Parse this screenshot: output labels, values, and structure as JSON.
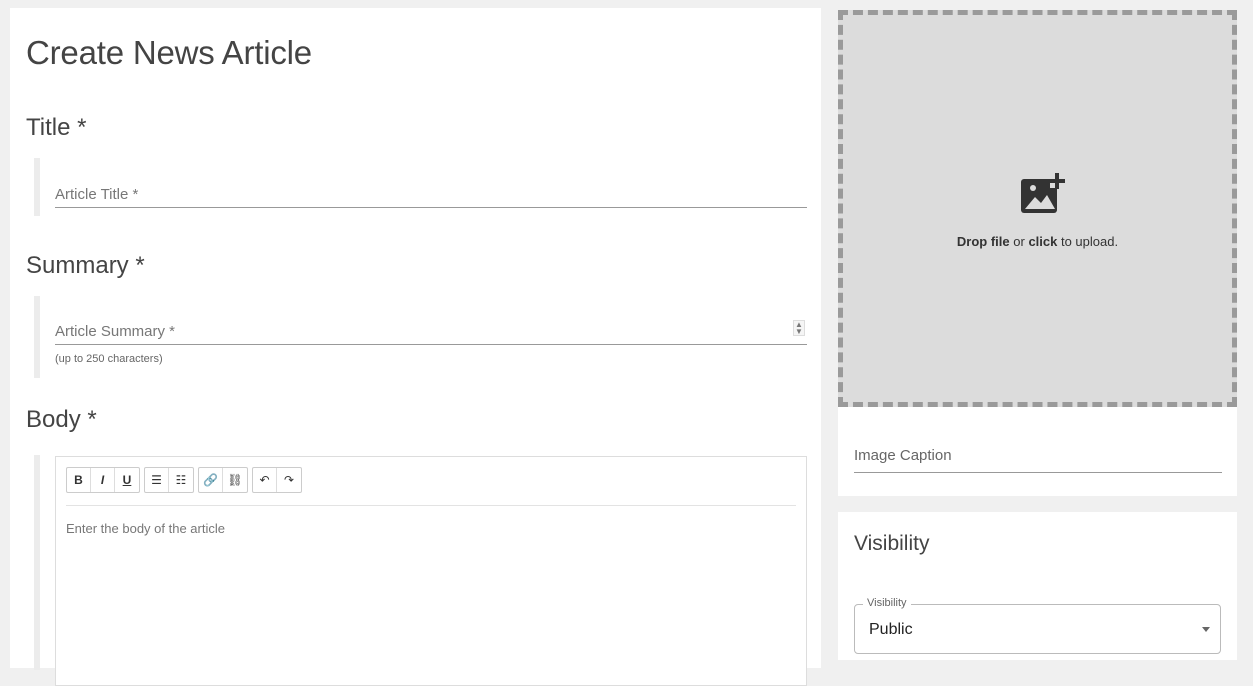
{
  "page": {
    "title": "Create News Article"
  },
  "title_section": {
    "heading": "Title *",
    "field_placeholder": "Article Title *"
  },
  "summary_section": {
    "heading": "Summary *",
    "field_placeholder": "Article Summary *",
    "helper_text": "(up to 250 characters)"
  },
  "body_section": {
    "heading": "Body *",
    "editor_placeholder": "Enter the body of the article",
    "toolbar": {
      "groups": [
        [
          {
            "icon": "bold-icon",
            "glyph": "B"
          },
          {
            "icon": "italic-icon",
            "glyph": "I"
          },
          {
            "icon": "underline-icon",
            "glyph": "U"
          }
        ],
        [
          {
            "icon": "bulleted-list-icon",
            "glyph": "☰"
          },
          {
            "icon": "numbered-list-icon",
            "glyph": "☷"
          }
        ],
        [
          {
            "icon": "link-icon",
            "glyph": "🔗"
          },
          {
            "icon": "unlink-icon",
            "glyph": "⛓"
          }
        ],
        [
          {
            "icon": "undo-icon",
            "glyph": "↶"
          },
          {
            "icon": "redo-icon",
            "glyph": "↷"
          }
        ]
      ]
    }
  },
  "upload": {
    "drop_text_strong": "Drop file",
    "drop_text_or": " or ",
    "drop_text_click": "click",
    "drop_text_rest": " to upload.",
    "icon": "add-photo-icon"
  },
  "caption": {
    "placeholder": "Image Caption"
  },
  "visibility": {
    "heading": "Visibility",
    "select_label": "Visibility",
    "selected_value": "Public"
  }
}
